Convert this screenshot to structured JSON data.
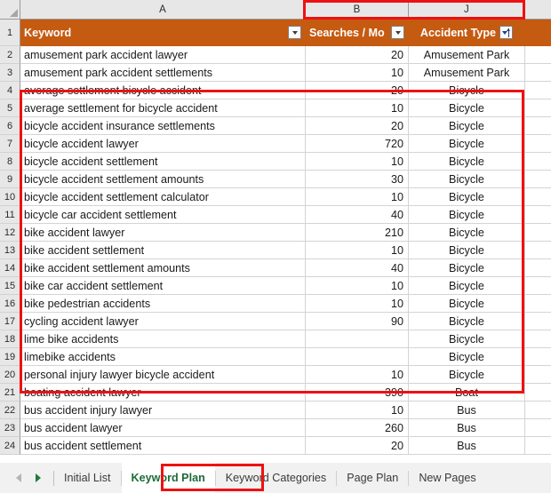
{
  "columns": {
    "letters": [
      "A",
      "B",
      "J"
    ],
    "widths": [
      321,
      116,
      131
    ]
  },
  "header": {
    "keyword_label": "Keyword",
    "searches_label": "Searches / Mo",
    "accident_type_label": "Accident Type",
    "fill_color": "#C55A11",
    "text_color": "#FFFFFF"
  },
  "table": {
    "rows": [
      {
        "n": "2",
        "keyword": "amusement park accident lawyer",
        "searches": "20",
        "type": "Amusement Park"
      },
      {
        "n": "3",
        "keyword": "amusement park accident settlements",
        "searches": "10",
        "type": "Amusement Park"
      },
      {
        "n": "4",
        "keyword": "average settlement bicycle accident",
        "searches": "20",
        "type": "Bicycle"
      },
      {
        "n": "5",
        "keyword": "average settlement for bicycle accident",
        "searches": "10",
        "type": "Bicycle"
      },
      {
        "n": "6",
        "keyword": "bicycle accident insurance settlements",
        "searches": "20",
        "type": "Bicycle"
      },
      {
        "n": "7",
        "keyword": "bicycle accident lawyer",
        "searches": "720",
        "type": "Bicycle"
      },
      {
        "n": "8",
        "keyword": "bicycle accident settlement",
        "searches": "10",
        "type": "Bicycle"
      },
      {
        "n": "9",
        "keyword": "bicycle accident settlement amounts",
        "searches": "30",
        "type": "Bicycle"
      },
      {
        "n": "10",
        "keyword": "bicycle accident settlement calculator",
        "searches": "10",
        "type": "Bicycle"
      },
      {
        "n": "11",
        "keyword": "bicycle car accident settlement",
        "searches": "40",
        "type": "Bicycle"
      },
      {
        "n": "12",
        "keyword": "bike accident lawyer",
        "searches": "210",
        "type": "Bicycle"
      },
      {
        "n": "13",
        "keyword": "bike accident settlement",
        "searches": "10",
        "type": "Bicycle"
      },
      {
        "n": "14",
        "keyword": "bike accident settlement amounts",
        "searches": "40",
        "type": "Bicycle"
      },
      {
        "n": "15",
        "keyword": "bike car accident settlement",
        "searches": "10",
        "type": "Bicycle"
      },
      {
        "n": "16",
        "keyword": "bike pedestrian accidents",
        "searches": "10",
        "type": "Bicycle"
      },
      {
        "n": "17",
        "keyword": "cycling accident lawyer",
        "searches": "90",
        "type": "Bicycle"
      },
      {
        "n": "18",
        "keyword": "lime bike accidents",
        "searches": "",
        "type": "Bicycle"
      },
      {
        "n": "19",
        "keyword": "limebike accidents",
        "searches": "",
        "type": "Bicycle"
      },
      {
        "n": "20",
        "keyword": "personal injury lawyer bicycle accident",
        "searches": "10",
        "type": "Bicycle"
      },
      {
        "n": "21",
        "keyword": "boating accident lawyer",
        "searches": "390",
        "type": "Boat"
      },
      {
        "n": "22",
        "keyword": "bus accident injury lawyer",
        "searches": "10",
        "type": "Bus"
      },
      {
        "n": "23",
        "keyword": "bus accident lawyer",
        "searches": "260",
        "type": "Bus"
      },
      {
        "n": "24",
        "keyword": "bus accident settlement",
        "searches": "20",
        "type": "Bus"
      }
    ]
  },
  "sheet_tabs": {
    "items": [
      {
        "label": "Initial List",
        "active": false
      },
      {
        "label": "Keyword Plan",
        "active": true
      },
      {
        "label": "Keyword Categories",
        "active": false
      },
      {
        "label": "Page Plan",
        "active": false
      },
      {
        "label": "New Pages",
        "active": false
      }
    ],
    "active_color": "#1D6B38"
  },
  "annotations": {
    "highlight_color": "#EE1111",
    "boxes": [
      "column-headers-b-and-j",
      "bicycle-rows-4-to-20",
      "keyword-plan-tab"
    ]
  }
}
